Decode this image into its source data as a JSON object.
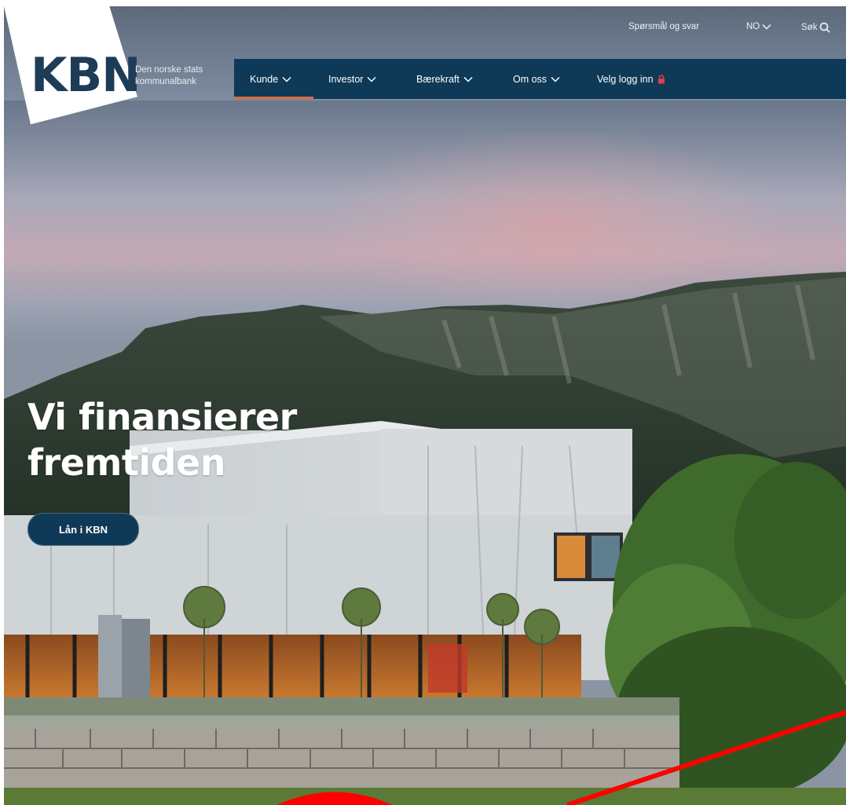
{
  "logo": {
    "text": "KBN",
    "tagline": "Den norske stats kommunalbank"
  },
  "utility_nav": {
    "faq_label": "Spørsmål og svar",
    "language_label": "NO",
    "search_label": "Søk"
  },
  "main_nav": {
    "items": [
      {
        "label": "Kunde",
        "active": true
      },
      {
        "label": "Investor"
      },
      {
        "label": "Bærekraft"
      },
      {
        "label": "Om oss"
      }
    ],
    "login_label": "Velg logg inn"
  },
  "hero": {
    "headline_line1": "Vi finansierer",
    "headline_line2": "fremtiden",
    "cta_label": "Lån i KBN"
  },
  "colors": {
    "brand_navy": "#0e3a57",
    "accent_orange": "#e4673d",
    "lock_red": "#e0404a",
    "annotation_red": "#ff0000"
  },
  "icons": {
    "chevron": "chevron-down-icon",
    "lock": "lock-icon",
    "search": "search-icon"
  }
}
